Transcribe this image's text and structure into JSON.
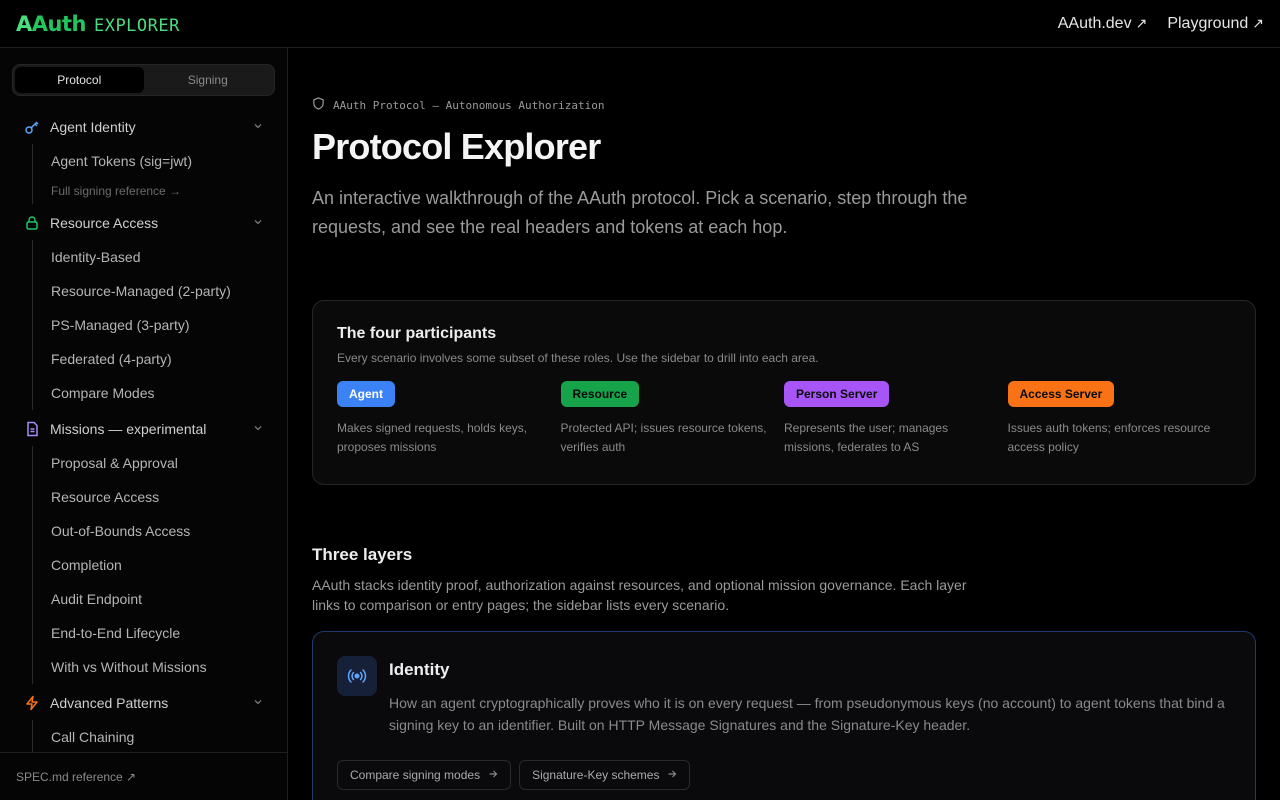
{
  "header": {
    "brand_a": "A",
    "brand_rest": "Auth",
    "brand_sub": "EXPLORER",
    "links": [
      {
        "label": "AAuth.dev",
        "arrow": "↗"
      },
      {
        "label": "Playground",
        "arrow": "↗"
      }
    ]
  },
  "sidebar": {
    "tabs": [
      {
        "label": "Protocol",
        "active": true
      },
      {
        "label": "Signing",
        "active": false
      }
    ],
    "groups": [
      {
        "label": "Agent Identity",
        "icon": "key-icon",
        "color": "#60a5fa",
        "items": [
          "Agent Tokens (sig=jwt)"
        ],
        "sub": "Full signing reference →"
      },
      {
        "label": "Resource Access",
        "icon": "lock-icon",
        "color": "#22c55e",
        "items": [
          "Identity-Based",
          "Resource-Managed (2-party)",
          "PS-Managed (3-party)",
          "Federated (4-party)",
          "Compare Modes"
        ]
      },
      {
        "label": "Missions — experimental",
        "icon": "document-icon",
        "color": "#a78bfa",
        "items": [
          "Proposal & Approval",
          "Resource Access",
          "Out-of-Bounds Access",
          "Completion",
          "Audit Endpoint",
          "End-to-End Lifecycle",
          "With vs Without Missions"
        ]
      },
      {
        "label": "Advanced Patterns",
        "icon": "bolt-icon",
        "color": "#f97316",
        "items": [
          "Call Chaining"
        ]
      }
    ],
    "footer": "SPEC.md reference ↗"
  },
  "main": {
    "eyebrow": "AAuth Protocol — Autonomous Authorization",
    "title": "Protocol Explorer",
    "lead": "An interactive walkthrough of the AAuth protocol. Pick a scenario, step through the requests, and see the real headers and tokens at each hop.",
    "participants": {
      "title": "The four participants",
      "subtitle": "Every scenario involves some subset of these roles. Use the sidebar to drill into each area.",
      "items": [
        {
          "label": "Agent",
          "color": "#3b82f6",
          "text_color": "#ffffff",
          "desc": "Makes signed requests, holds keys, proposes missions"
        },
        {
          "label": "Resource",
          "color": "#16a34a",
          "text_color": "#0a0a0a",
          "desc": "Protected API; issues resource tokens, verifies auth"
        },
        {
          "label": "Person Server",
          "color": "#a855f7",
          "text_color": "#0a0a0a",
          "desc": "Represents the user; manages missions, federates to AS"
        },
        {
          "label": "Access Server",
          "color": "#f97316",
          "text_color": "#0a0a0a",
          "desc": "Issues auth tokens; enforces resource access policy"
        }
      ]
    },
    "layers": {
      "title": "Three layers",
      "subtitle": "AAuth stacks identity proof, authorization against resources, and optional mission governance. Each layer links to comparison or entry pages; the sidebar lists every scenario.",
      "identity": {
        "title": "Identity",
        "desc": "How an agent cryptographically proves who it is on every request — from pseudonymous keys (no account) to agent tokens that bind a signing key to an identifier. Built on HTTP Message Signatures and the Signature-Key header.",
        "links": [
          "Compare signing modes",
          "Signature-Key schemes"
        ]
      }
    }
  }
}
